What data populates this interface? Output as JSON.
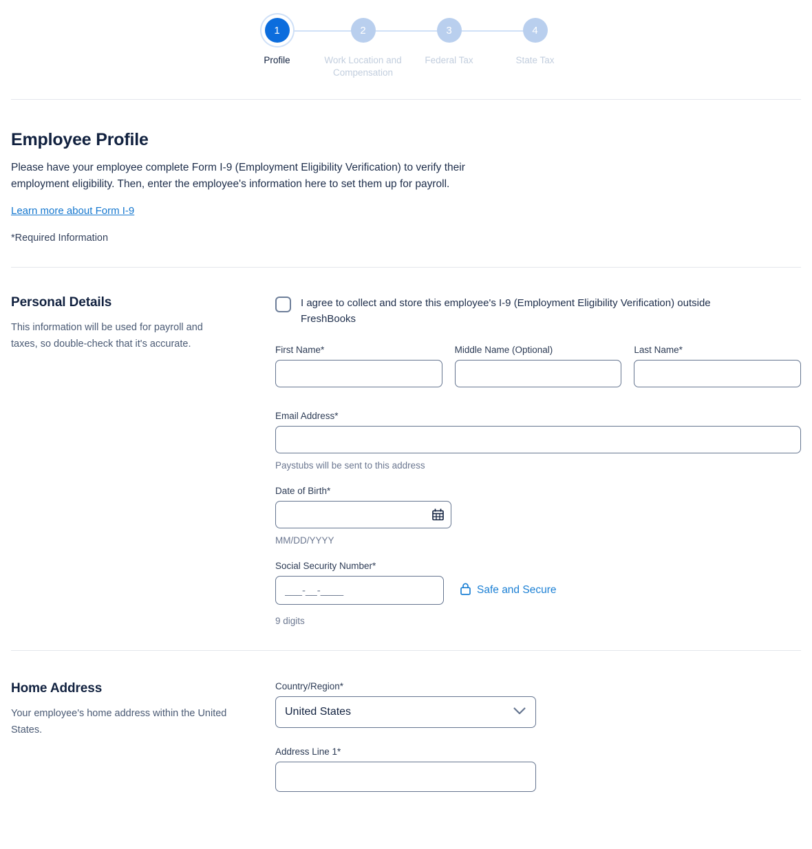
{
  "stepper": {
    "steps": [
      {
        "number": "1",
        "label": "Profile",
        "state": "active"
      },
      {
        "number": "2",
        "label": "Work Location and Compensation",
        "state": "inactive"
      },
      {
        "number": "3",
        "label": "Federal Tax",
        "state": "inactive"
      },
      {
        "number": "4",
        "label": "State Tax",
        "state": "inactive"
      }
    ]
  },
  "header": {
    "title": "Employee Profile",
    "description": "Please have your employee complete Form I-9 (Employment Eligibility Verification) to verify their employment eligibility. Then, enter the employee's information here to set them up for payroll.",
    "link_label": "Learn more about Form I-9",
    "required_note": "*Required Information"
  },
  "personal_details": {
    "title": "Personal Details",
    "subtitle": "This information will be used for payroll and taxes, so double-check that it's accurate.",
    "consent_checkbox": {
      "label": "I agree to collect and store this employee's I-9 (Employment Eligibility Verification) outside FreshBooks",
      "checked": false
    },
    "first_name": {
      "label": "First Name*",
      "value": "",
      "placeholder": ""
    },
    "middle_name": {
      "label": "Middle Name (Optional)",
      "value": "",
      "placeholder": ""
    },
    "last_name": {
      "label": "Last Name*",
      "value": "",
      "placeholder": ""
    },
    "email": {
      "label": "Email Address*",
      "value": "",
      "placeholder": "",
      "helper": "Paystubs will be sent to this address"
    },
    "date_of_birth": {
      "label": "Date of Birth*",
      "value": "",
      "placeholder": "",
      "helper": "MM/DD/YYYY",
      "icon": "calendar-icon"
    },
    "ssn": {
      "label": "Social Security Number*",
      "value": "",
      "placeholder": "___-__-____",
      "helper": "9 digits",
      "secure_note": "Safe and Secure",
      "secure_icon": "lock-icon"
    }
  },
  "home_address": {
    "title": "Home Address",
    "subtitle": "Your employee's home address within the United States.",
    "country": {
      "label": "Country/Region*",
      "value": "United States",
      "options": [
        "United States"
      ],
      "icon": "chevron-down-icon"
    },
    "address_line_1": {
      "label": "Address Line 1*",
      "value": "",
      "placeholder": ""
    }
  },
  "colors": {
    "accent_blue": "#0c6ddd",
    "link_blue": "#1477cf",
    "secure_blue": "#1a7fd4",
    "step_inactive": "#b9cfee",
    "navy": "#11213f",
    "border": "#64748f",
    "divider": "#e4e6ec"
  }
}
